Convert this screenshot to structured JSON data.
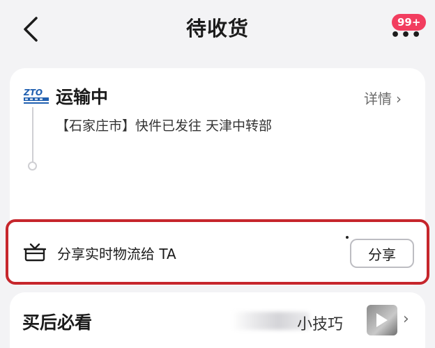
{
  "header": {
    "title": "待收货",
    "badge": "99+",
    "more_icon": "more-dots-icon",
    "back_icon": "chevron-left-icon"
  },
  "shipment": {
    "carrier_logo": "ZTO",
    "status": "运输中",
    "details_label": "详情",
    "tracking_text": "【石家庄市】快件已发往 天津中转部"
  },
  "share": {
    "text": "分享实时物流给 TA",
    "button_label": "分享",
    "icon": "gift-box-icon"
  },
  "after_purchase": {
    "title": "买后必看",
    "tip_text": "小技巧",
    "thumb_icon": "play-icon"
  },
  "colors": {
    "badge": "#f23d5f",
    "highlight_border": "#c6262c",
    "background": "#f3f3f5"
  }
}
